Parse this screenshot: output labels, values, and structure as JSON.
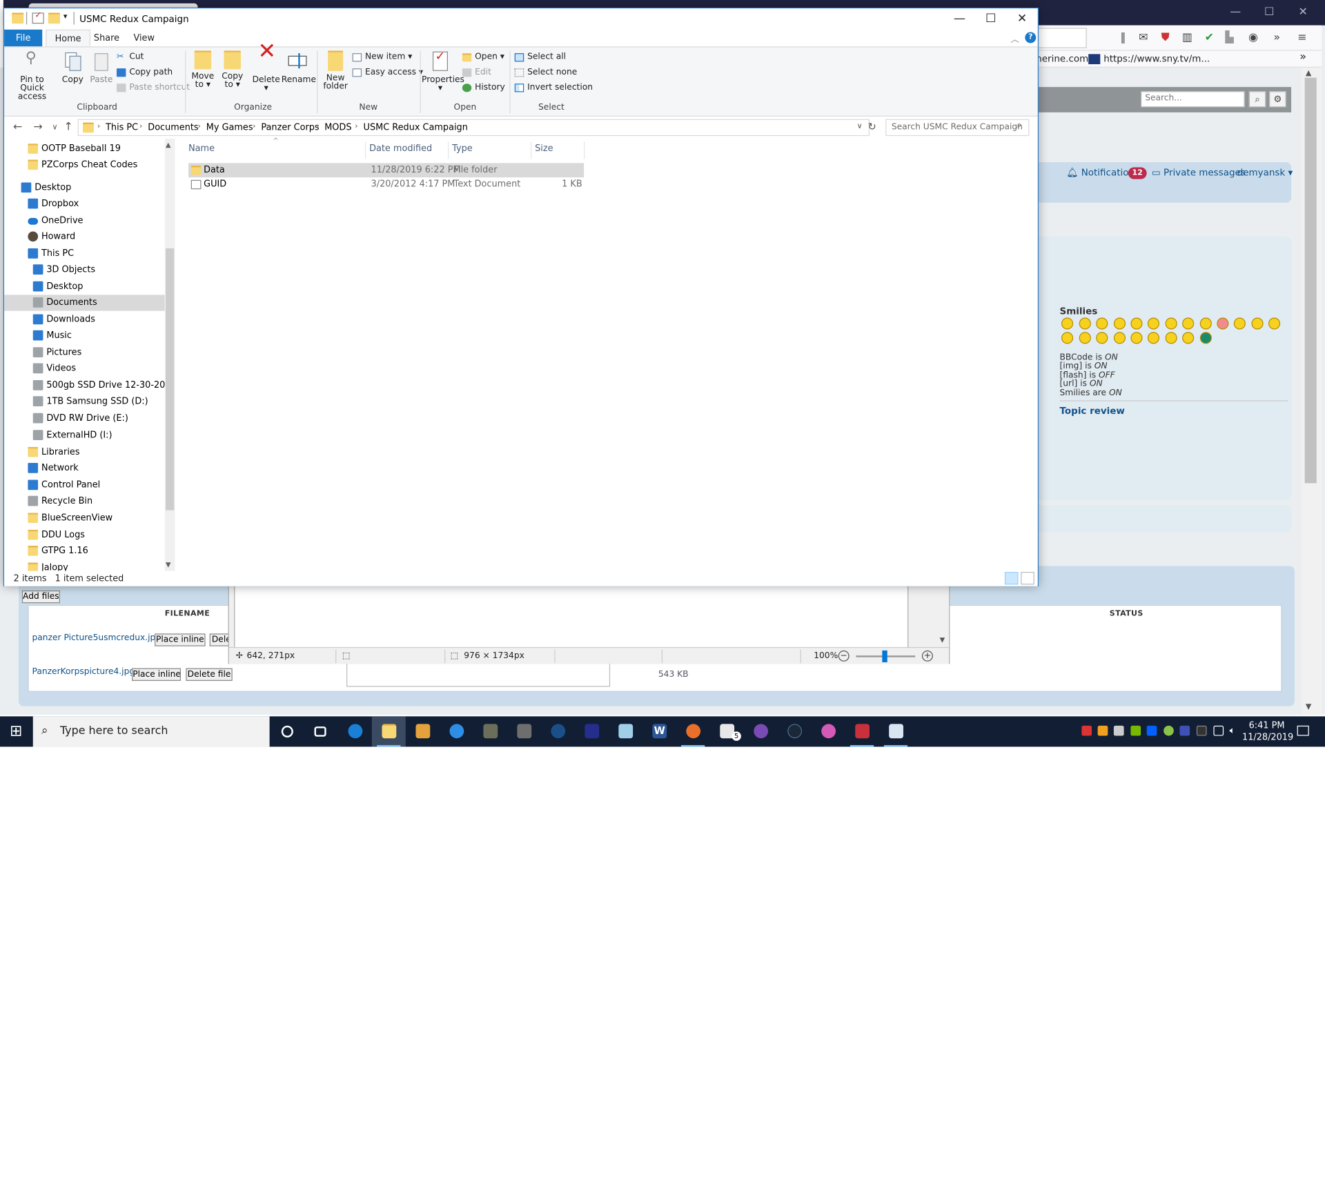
{
  "explorer": {
    "title": "USMC Redux Campaign",
    "tabs": {
      "file": "File",
      "home": "Home",
      "share": "Share",
      "view": "View"
    },
    "ribbon": {
      "clipboard": {
        "pin": "Pin to Quick",
        "pin2": "access",
        "copy": "Copy",
        "paste": "Paste",
        "cut": "Cut",
        "copy_path": "Copy path",
        "paste_shortcut": "Paste shortcut",
        "label": "Clipboard"
      },
      "organize": {
        "move": "Move",
        "move2": "to",
        "copy_to": "Copy",
        "copy_to2": "to",
        "delete": "Delete",
        "rename": "Rename",
        "label": "Organize"
      },
      "new": {
        "new_folder": "New",
        "new_folder2": "folder",
        "new_item": "New item",
        "easy_access": "Easy access",
        "label": "New"
      },
      "open": {
        "properties": "Properties",
        "open": "Open",
        "edit": "Edit",
        "history": "History",
        "label": "Open"
      },
      "select": {
        "select_all": "Select all",
        "select_none": "Select none",
        "invert": "Invert selection",
        "label": "Select"
      }
    },
    "breadcrumb": [
      "This PC",
      "Documents",
      "My Games",
      "Panzer Corps",
      "MODS",
      "USMC Redux Campaign"
    ],
    "search_placeholder": "Search USMC Redux Campaign",
    "nav": [
      {
        "label": "OOTP Baseball 19",
        "icon": "folder-icon"
      },
      {
        "label": "PZCorps Cheat Codes",
        "icon": "folder-icon"
      },
      {
        "label": "Desktop",
        "icon": "desktop-icon"
      },
      {
        "label": "Dropbox",
        "icon": "dropbox-icon"
      },
      {
        "label": "OneDrive",
        "icon": "onedrive-icon"
      },
      {
        "label": "Howard",
        "icon": "user-icon"
      },
      {
        "label": "This PC",
        "icon": "computer-icon"
      },
      {
        "label": "3D Objects",
        "icon": "cube-icon"
      },
      {
        "label": "Desktop",
        "icon": "desktop-icon"
      },
      {
        "label": "Documents",
        "icon": "documents-icon"
      },
      {
        "label": "Downloads",
        "icon": "download-icon"
      },
      {
        "label": "Music",
        "icon": "music-icon"
      },
      {
        "label": "Pictures",
        "icon": "pictures-icon"
      },
      {
        "label": "Videos",
        "icon": "videos-icon"
      },
      {
        "label": "500gb SSD Drive 12-30-2016 (C:)",
        "icon": "drive-icon"
      },
      {
        "label": "1TB Samsung SSD (D:)",
        "icon": "drive-icon"
      },
      {
        "label": "DVD RW Drive (E:)",
        "icon": "dvd-icon"
      },
      {
        "label": "ExternalHD (I:)",
        "icon": "drive-icon"
      },
      {
        "label": "Libraries",
        "icon": "libraries-icon"
      },
      {
        "label": "Network",
        "icon": "network-icon"
      },
      {
        "label": "Control Panel",
        "icon": "control-panel-icon"
      },
      {
        "label": "Recycle Bin",
        "icon": "recycle-bin-icon"
      },
      {
        "label": "BlueScreenView",
        "icon": "folder-icon"
      },
      {
        "label": "DDU Logs",
        "icon": "folder-icon"
      },
      {
        "label": "GTPG 1.16",
        "icon": "folder-icon"
      },
      {
        "label": "Jalopy",
        "icon": "folder-icon"
      }
    ],
    "columns": {
      "name": "Name",
      "date": "Date modified",
      "type": "Type",
      "size": "Size"
    },
    "files": [
      {
        "name": "Data",
        "date": "11/28/2019 6:22 PM",
        "type": "File folder",
        "size": ""
      },
      {
        "name": "GUID",
        "date": "3/20/2012 4:17 PM",
        "type": "Text Document",
        "size": "1 KB"
      }
    ],
    "status": {
      "count": "2 items",
      "selected": "1 item selected"
    }
  },
  "browser": {
    "bookmark1": "nerine.com/",
    "bookmark2": "https://www.sny.tv/m...",
    "search_placeholder": "Search...",
    "notifications": "Notifications",
    "notif_count": "12",
    "private_messages": "Private messages",
    "username": "demyansk",
    "smilies_title": "Smilies",
    "bbcode": [
      {
        "label": "BBCode is ",
        "state": "ON"
      },
      {
        "label": "[img] is ",
        "state": "ON"
      },
      {
        "label": "[flash] is ",
        "state": "OFF"
      },
      {
        "label": "[url] is ",
        "state": "ON"
      },
      {
        "label": "Smilies are ",
        "state": "ON"
      }
    ],
    "topic_review": "Topic review",
    "add_files": "Add files",
    "filename_header": "FILENAME",
    "status_header": "STATUS",
    "attachments": [
      {
        "name": "panzer Picture5usmcredux.jpg",
        "place": "Place inline",
        "delete": "Dele"
      },
      {
        "name": "PanzerKorpspicture4.jpg",
        "place": "Place inline",
        "delete": "Delete file"
      }
    ],
    "att_size": "543 KB"
  },
  "viewer": {
    "cursor_pos": "642, 271px",
    "dimensions": "976 × 1734px",
    "zoom": "100%"
  },
  "taskbar": {
    "search_placeholder": "Type here to search",
    "time": "6:41 PM",
    "date": "11/28/2019",
    "mail_badge": "5"
  }
}
